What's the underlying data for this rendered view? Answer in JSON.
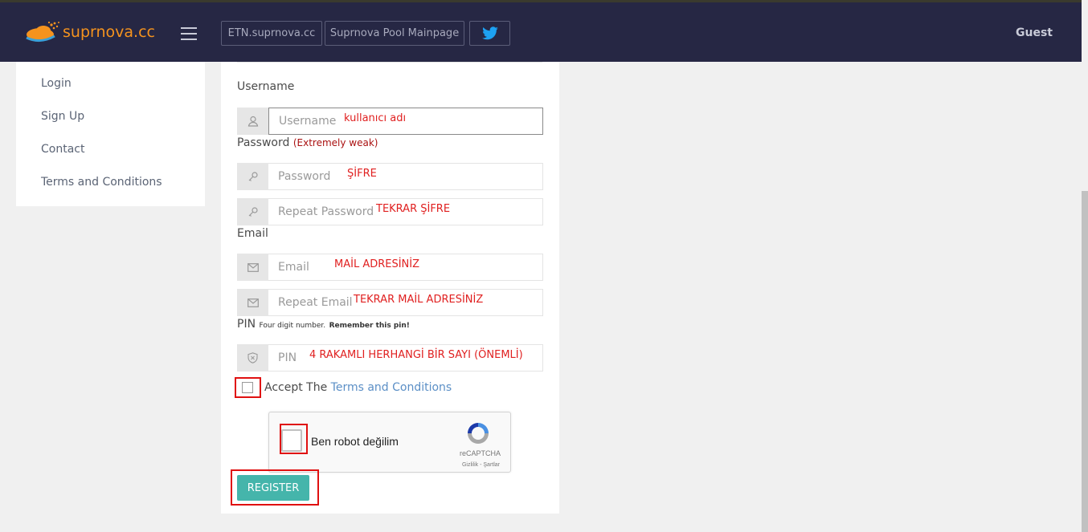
{
  "header": {
    "logo_text": "suprnova.cc",
    "nav_buttons": [
      "ETN.suprnova.cc",
      "Suprnova Pool Mainpage"
    ],
    "user_label": "Guest"
  },
  "sidebar": {
    "items": [
      {
        "label": "Login"
      },
      {
        "label": "Sign Up"
      },
      {
        "label": "Contact"
      },
      {
        "label": "Terms and Conditions"
      }
    ]
  },
  "form": {
    "username_label": "Username",
    "username_placeholder": "Username",
    "username_annotation": "kullanıcı adı",
    "password_label": "Password",
    "password_strength": "(Extremely weak)",
    "password_placeholder": "Password",
    "password_annotation": "ŞİFRE",
    "repeat_password_placeholder": "Repeat Password",
    "repeat_password_annotation": "TEKRAR ŞİFRE",
    "email_label": "Email",
    "email_placeholder": "Email",
    "email_annotation": "MAİL ADRESİNİZ",
    "repeat_email_placeholder": "Repeat Email",
    "repeat_email_annotation": "TEKRAR MAİL ADRESİNİZ",
    "pin_label": "PIN",
    "pin_hint": "Four digit number.",
    "pin_hint_bold": "Remember this pin!",
    "pin_placeholder": "PIN",
    "pin_annotation": "4 RAKAMLI HERHANGİ BİR SAYI (ÖNEMLİ)",
    "accept_text": "Accept The",
    "terms_link": "Terms and Conditions",
    "captcha_text": "Ben robot değilim",
    "captcha_brand": "reCAPTCHA",
    "captcha_links": "Gizlilik - Şartlar",
    "register_label": "REGISTER"
  },
  "colors": {
    "topbar": "#262744",
    "logo": "#f5931e",
    "accent_button": "#45b5ab",
    "annotation_red": "#e02020",
    "link": "#5b8fc6"
  }
}
